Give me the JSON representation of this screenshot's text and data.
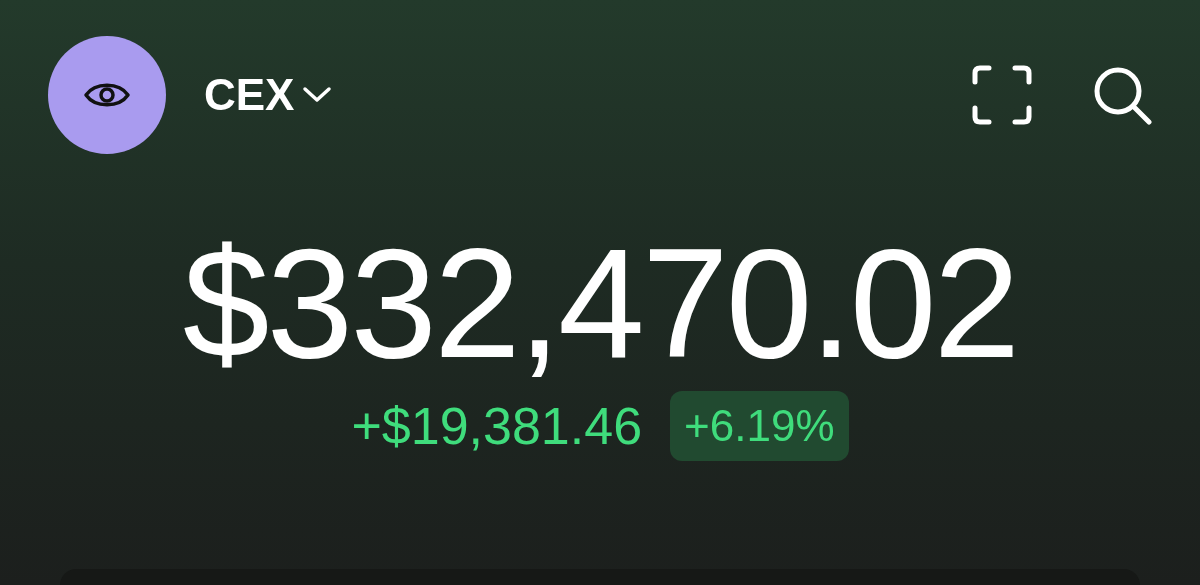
{
  "account": {
    "label": "CEX"
  },
  "balance": "$332,470.02",
  "change": {
    "amount": "+$19,381.46",
    "percent": "+6.19%"
  }
}
